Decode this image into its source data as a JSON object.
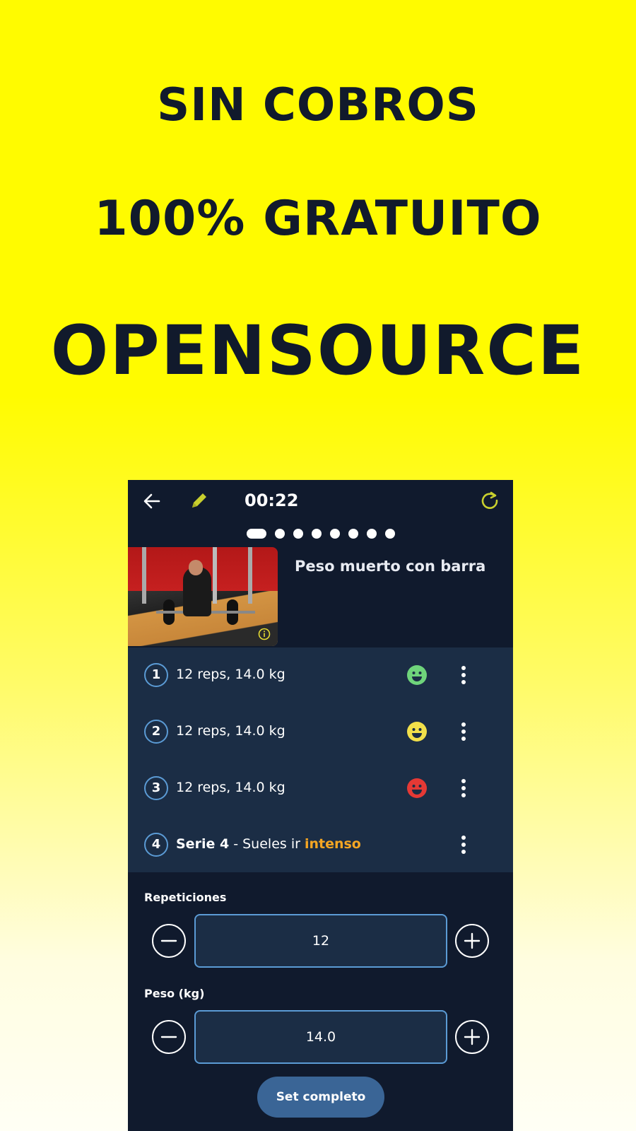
{
  "promo": {
    "line1": "SIN COBROS",
    "line2": "100% GRATUITO",
    "line3": "OPENSOURCE"
  },
  "app": {
    "timer": "00:22",
    "icons": {
      "back": "arrow-left",
      "edit": "pencil",
      "reset": "refresh"
    },
    "pager": {
      "total": 8,
      "active": 1
    },
    "exercise_title": "Peso muerto con barra",
    "sets": [
      {
        "number": "1",
        "text": "12 reps, 14.0 kg",
        "face": "happy-green",
        "face_color": "#6fd47b"
      },
      {
        "number": "2",
        "text": "12 reps, 14.0 kg",
        "face": "happy-yellow",
        "face_color": "#f2e04a"
      },
      {
        "number": "3",
        "text": "12 reps, 14.0 kg",
        "face": "happy-red",
        "face_color": "#e53935"
      },
      {
        "number": "4",
        "title": "Serie 4",
        "sep": " - Sueles ir ",
        "highlight": "intenso"
      }
    ],
    "reps_label": "Repeticiones",
    "reps_value": "12",
    "weight_label": "Peso (kg)",
    "weight_value": "14.0",
    "complete_label": "Set completo"
  },
  "colors": {
    "background": "#fffb00",
    "headline": "#111a2c",
    "panel": "#101a2d",
    "sets_bg": "#1b2d45",
    "accent": "#5b9bd5",
    "edit_icon": "#c8cf2e",
    "highlight": "#f5a623"
  }
}
